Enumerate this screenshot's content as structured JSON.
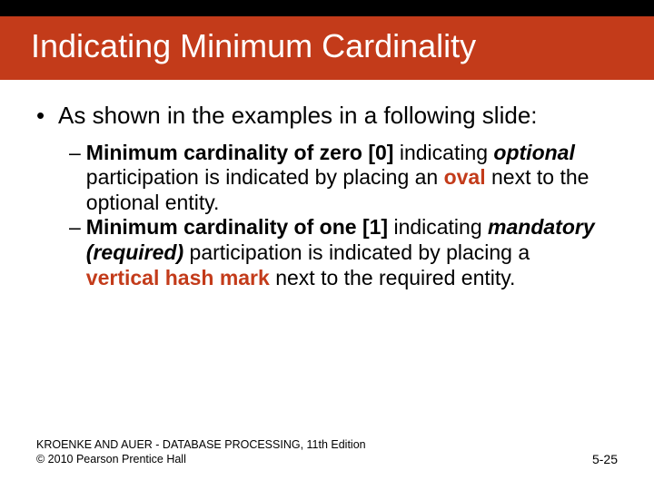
{
  "title": "Indicating Minimum Cardinality",
  "bullet1": "As shown in the examples in a following slide:",
  "sub1": {
    "lead": "Minimum cardinality of zero [0]",
    "mid1": " indicating ",
    "optional": "optional",
    "mid2": " participation is indicated by placing an ",
    "oval": "oval",
    "tail": " next to the optional entity."
  },
  "sub2": {
    "lead": "Minimum cardinality of one [1]",
    "mid1": " indicating ",
    "mandatory": "mandatory (required)",
    "mid2": " participation is indicated by placing a ",
    "hash": "vertical hash mark",
    "tail": " next to the required entity."
  },
  "footer": {
    "line1": "KROENKE AND AUER - DATABASE PROCESSING, 11th Edition",
    "line2": "© 2010 Pearson Prentice Hall",
    "pagenum": "5-25"
  }
}
